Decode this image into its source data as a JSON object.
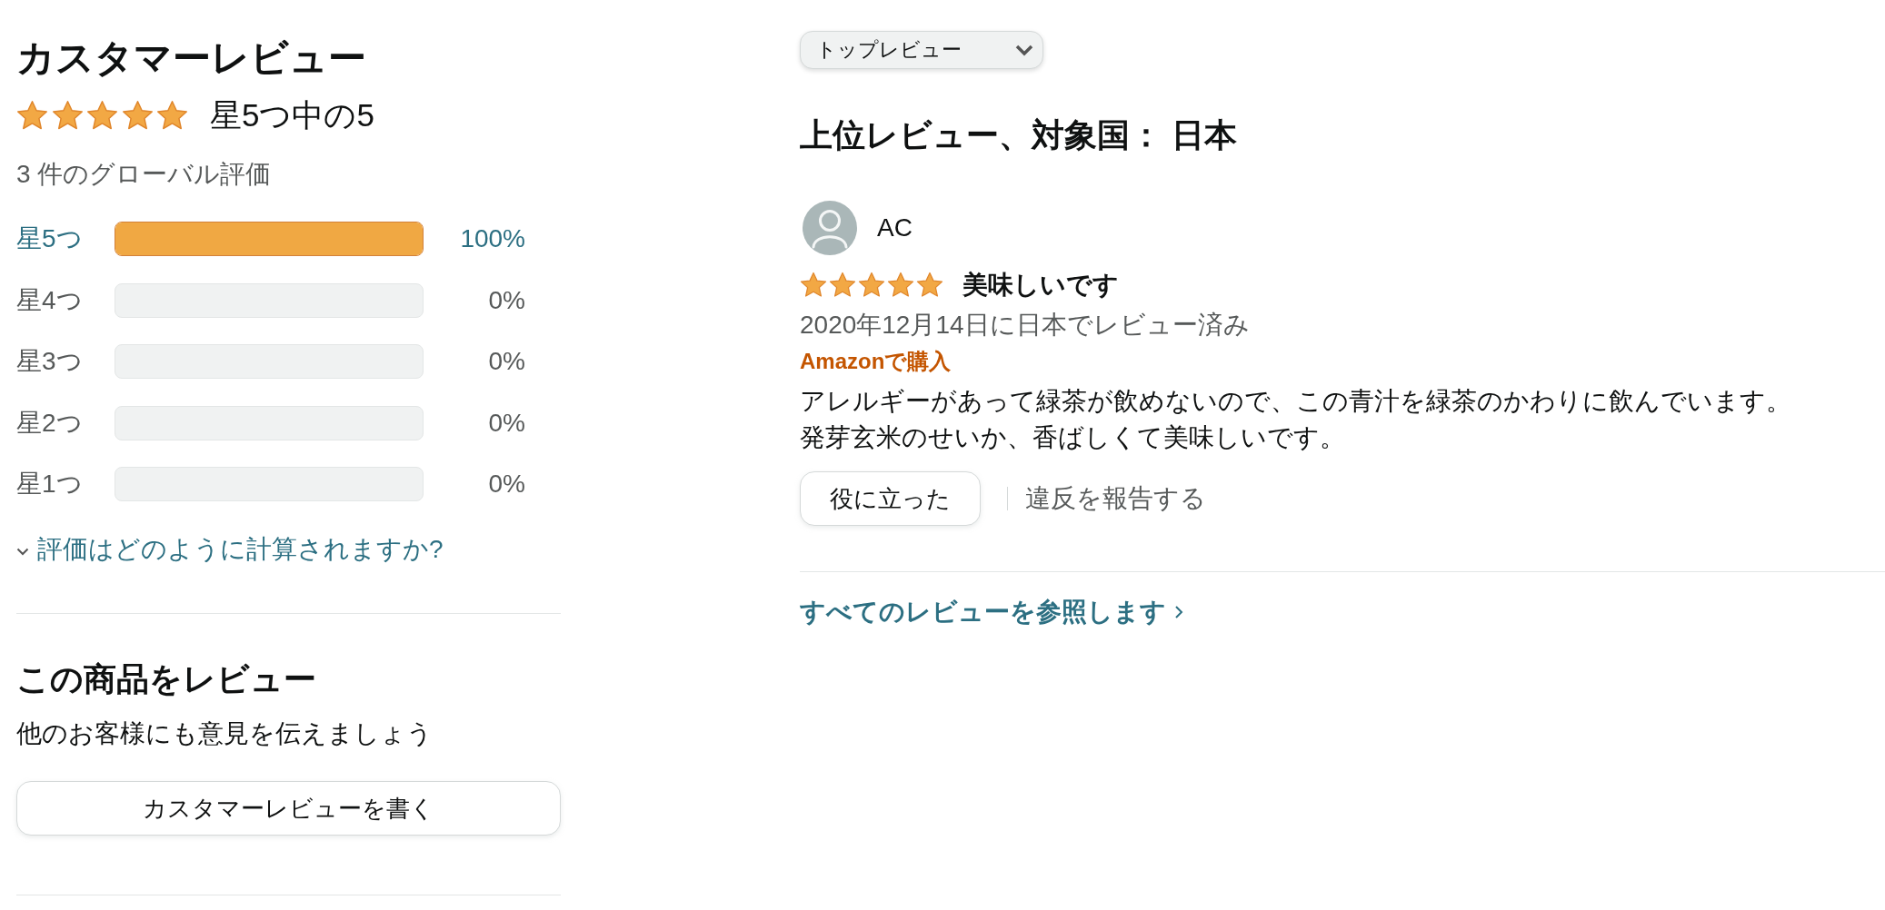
{
  "customer_reviews": {
    "title": "カスタマーレビュー",
    "stars": 5,
    "rating": "星5つ中の5",
    "global_ratings": "3 件のグローバル評価",
    "histogram": [
      {
        "label": "星5つ",
        "level": 1,
        "percent": "100%",
        "disabled": false
      },
      {
        "label": "星4つ",
        "level": 0,
        "percent": "0%",
        "disabled": true
      },
      {
        "label": "星3つ",
        "level": 0,
        "percent": "0%",
        "disabled": true
      },
      {
        "label": "星2つ",
        "level": 0,
        "percent": "0%",
        "disabled": true
      },
      {
        "label": "星1つ",
        "level": 0,
        "percent": "0%",
        "disabled": true
      }
    ],
    "help_link": {
      "label": "評価はどのように計算されますか?",
      "expanded": false
    }
  },
  "write_review": {
    "title": "この商品をレビュー",
    "text": "他のお客様にも意見を伝えましょう",
    "button": "カスタマーレビューを書く"
  },
  "sort_dropdown": {
    "value": "トップレビュー"
  },
  "top_reviews": {
    "heading": "上位レビュー、対象国： 日本",
    "reviews": [
      {
        "author": "AC",
        "stars": 5,
        "title": "美味しいです",
        "date": "2020年12月14日に日本でレビュー済み",
        "badge": "Amazonで購入",
        "body": "アレルギーがあって緑茶が飲めないので、この青汁を緑茶のかわりに飲んでいます。発芽玄米のせいか、香ばしくて美味しいです。",
        "helpful_button": "役に立った",
        "report_link": "違反を報告する"
      }
    ],
    "see_all_link": "すべてのレビューを参照します"
  }
}
